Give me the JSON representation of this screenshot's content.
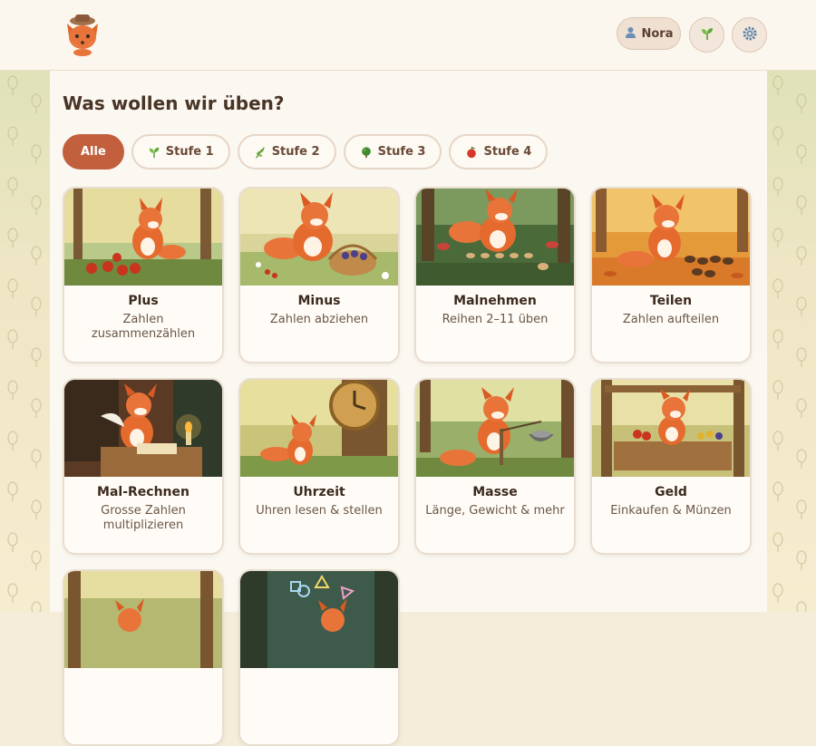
{
  "app": {
    "logo": "fox-logo"
  },
  "header": {
    "profile_icon": "user-icon",
    "profile_name": "Nora",
    "level_button_icon": "sprout-icon",
    "settings_button_icon": "gear-icon"
  },
  "page": {
    "title": "Was wollen wir üben?"
  },
  "filters": [
    {
      "label": "Alle",
      "active": true
    },
    {
      "label": "Stufe 1",
      "icon": "sprout-icon"
    },
    {
      "label": "Stufe 2",
      "icon": "herb-icon"
    },
    {
      "label": "Stufe 3",
      "icon": "tree-icon"
    },
    {
      "label": "Stufe 4",
      "icon": "apple-icon"
    }
  ],
  "cards": [
    {
      "name": "Plus",
      "desc": "Zahlen zusammenzählen"
    },
    {
      "name": "Minus",
      "desc": "Zahlen abziehen"
    },
    {
      "name": "Malnehmen",
      "desc": "Reihen 2–11 üben"
    },
    {
      "name": "Teilen",
      "desc": "Zahlen aufteilen"
    },
    {
      "name": "Mal-Rechnen",
      "desc": "Grosse Zahlen multiplizieren"
    },
    {
      "name": "Uhrzeit",
      "desc": "Uhren lesen & stellen"
    },
    {
      "name": "Masse",
      "desc": "Länge, Gewicht & mehr"
    },
    {
      "name": "Geld",
      "desc": "Einkaufen & Münzen"
    },
    {
      "name": "",
      "desc": ""
    },
    {
      "name": "",
      "desc": ""
    }
  ],
  "colors": {
    "accent": "#c2603e",
    "background": "#f5ecd9",
    "panel": "#fbf8f1",
    "text": "#4a3426"
  }
}
